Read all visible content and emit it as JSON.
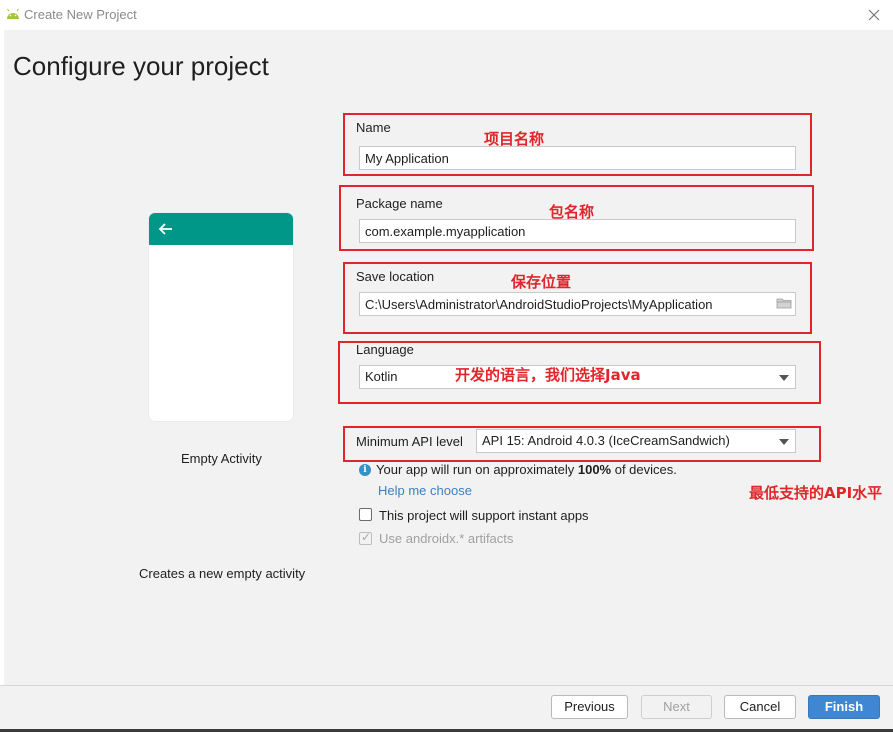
{
  "window": {
    "title": "Create New Project",
    "icon": "android-icon"
  },
  "page": {
    "title": "Configure your project"
  },
  "template": {
    "name": "Empty Activity",
    "description": "Creates a new empty activity",
    "appbar_color": "#009688"
  },
  "form": {
    "name": {
      "label": "Name",
      "value": "My Application"
    },
    "package": {
      "label": "Package name",
      "value": "com.example.myapplication"
    },
    "save_location": {
      "label": "Save location",
      "value": "C:\\Users\\Administrator\\AndroidStudioProjects\\MyApplication"
    },
    "language": {
      "label": "Language",
      "value": "Kotlin"
    },
    "min_api": {
      "label": "Minimum API level",
      "value": "API 15: Android 4.0.3 (IceCreamSandwich)"
    },
    "info": {
      "prefix": "Your app will run on approximately ",
      "percent": "100%",
      "suffix": " of devices."
    },
    "help_link": "Help me choose",
    "instant_apps": {
      "label": "This project will support instant apps",
      "checked": false
    },
    "androidx": {
      "label": "Use androidx.* artifacts",
      "checked": true,
      "disabled": true
    }
  },
  "annotations": {
    "name": "项目名称",
    "package": "包名称",
    "save_location": "保存位置",
    "language": "开发的语言，我们选择Java",
    "min_api": "最低支持的API水平",
    "color": "#e0262b"
  },
  "buttons": {
    "previous": "Previous",
    "next": "Next",
    "cancel": "Cancel",
    "finish": "Finish"
  }
}
